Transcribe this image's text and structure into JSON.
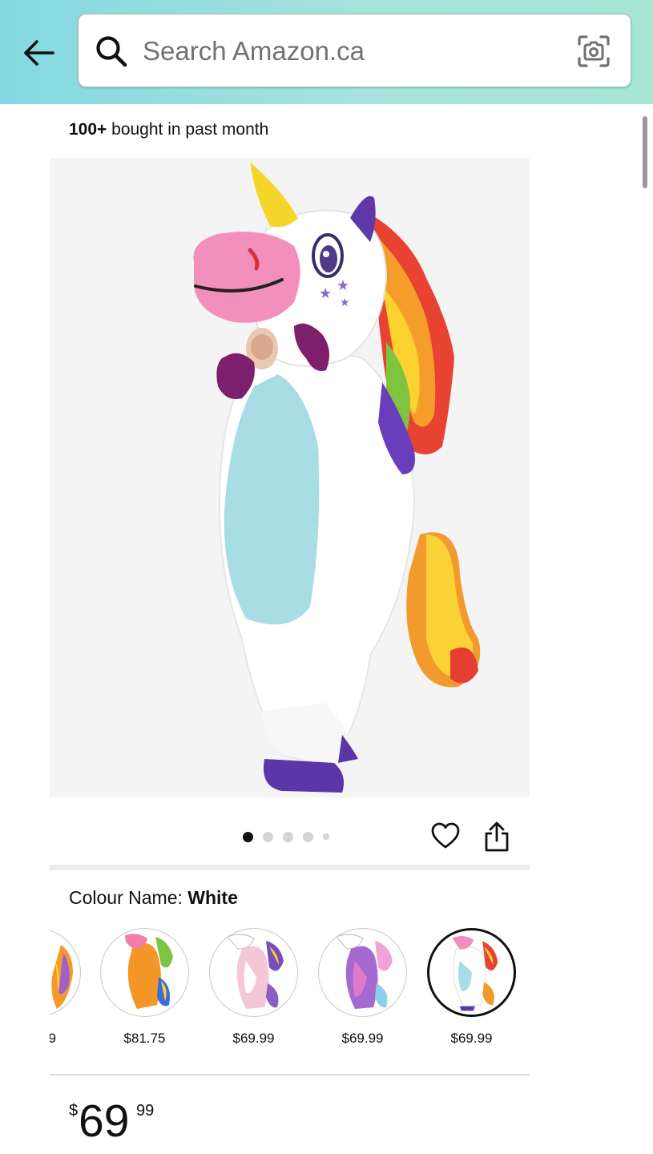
{
  "header": {
    "search_placeholder": "Search Amazon.ca"
  },
  "product": {
    "bought_count": "100+",
    "bought_text": " bought in past month",
    "image_count": 5,
    "active_image_index": 0,
    "colour_label": "Colour Name: ",
    "colour_value": "White",
    "variants": [
      {
        "price": "9",
        "color": "rainbow",
        "selected": false
      },
      {
        "price": "$81.75",
        "color": "orange",
        "selected": false
      },
      {
        "price": "$69.99",
        "color": "pink-white",
        "selected": false
      },
      {
        "price": "$69.99",
        "color": "purple",
        "selected": false
      },
      {
        "price": "$69.99",
        "color": "white",
        "selected": true
      }
    ],
    "price": {
      "symbol": "$",
      "whole": "69",
      "fraction": "99"
    }
  },
  "colors": {
    "header_gradient_start": "#84d8e2",
    "header_gradient_end": "#a6e6d3",
    "text": "#0f1111"
  }
}
